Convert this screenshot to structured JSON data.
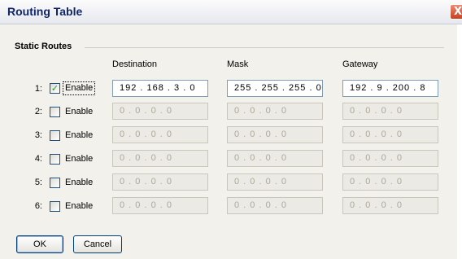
{
  "window": {
    "title": "Routing Table",
    "close_glyph": "X"
  },
  "section": {
    "title": "Static Routes"
  },
  "columns": {
    "destination": "Destination",
    "mask": "Mask",
    "gateway": "Gateway"
  },
  "enable_label": "Enable",
  "rows": [
    {
      "num": "1:",
      "enabled": true,
      "check": "✓",
      "destination": "192 . 168 .  3  .  0",
      "mask": "255 . 255 . 255 .  0",
      "gateway": "192 .  9  . 200 .  8"
    },
    {
      "num": "2:",
      "enabled": false,
      "check": "",
      "destination": "0  .  0  .  0  .  0",
      "mask": "0  .  0  .  0  .  0",
      "gateway": "0  .  0  .  0  .  0"
    },
    {
      "num": "3:",
      "enabled": false,
      "check": "",
      "destination": "0  .  0  .  0  .  0",
      "mask": "0  .  0  .  0  .  0",
      "gateway": "0  .  0  .  0  .  0"
    },
    {
      "num": "4:",
      "enabled": false,
      "check": "",
      "destination": "0  .  0  .  0  .  0",
      "mask": "0  .  0  .  0  .  0",
      "gateway": "0  .  0  .  0  .  0"
    },
    {
      "num": "5:",
      "enabled": false,
      "check": "",
      "destination": "0  .  0  .  0  .  0",
      "mask": "0  .  0  .  0  .  0",
      "gateway": "0  .  0  .  0  .  0"
    },
    {
      "num": "6:",
      "enabled": false,
      "check": "",
      "destination": "0  .  0  .  0  .  0",
      "mask": "0  .  0  .  0  .  0",
      "gateway": "0  .  0  .  0  .  0"
    }
  ],
  "buttons": {
    "ok": "OK",
    "cancel": "Cancel"
  },
  "colors": {
    "title_text": "#10246a",
    "check_mark": "#21a121",
    "close_button": "#c6411f"
  }
}
